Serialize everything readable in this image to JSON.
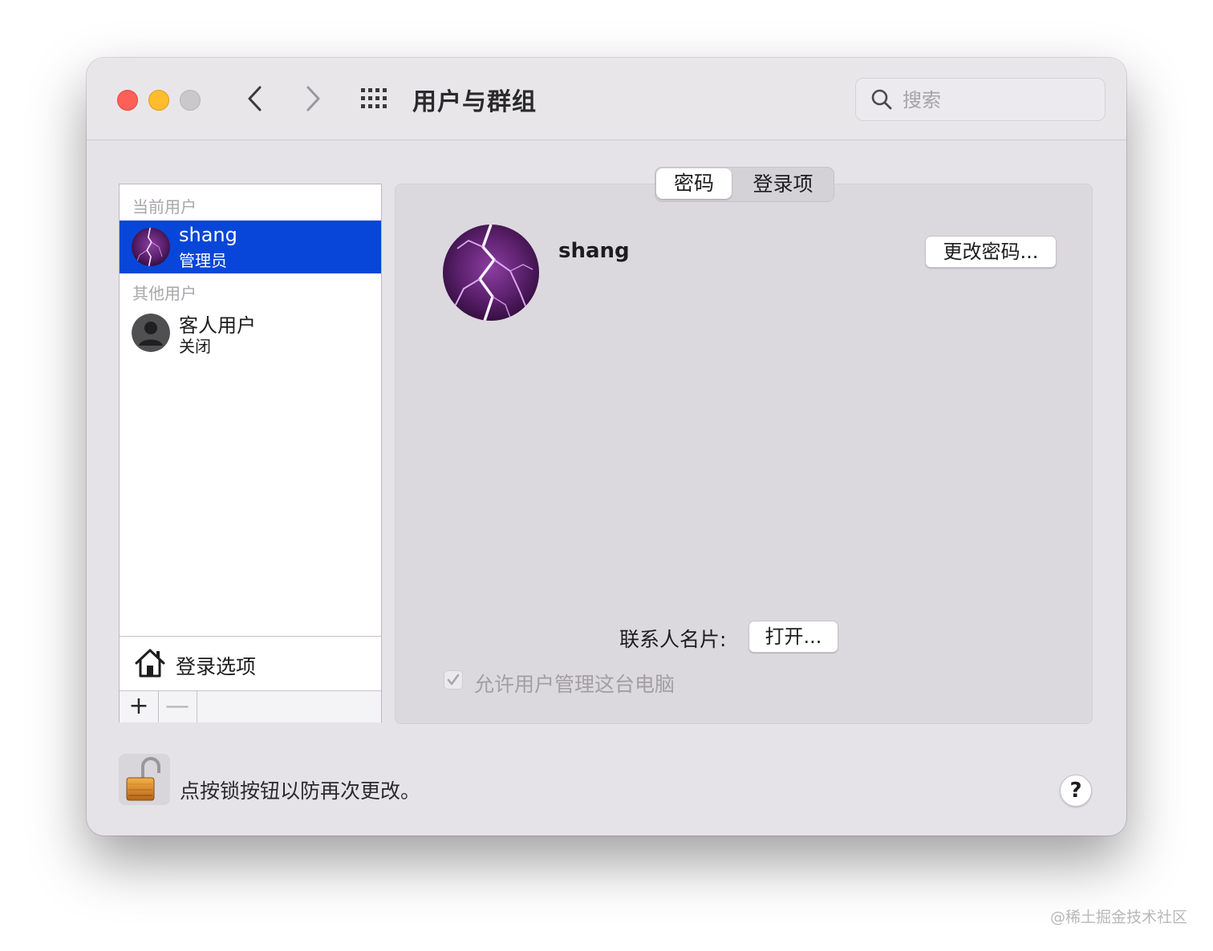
{
  "window": {
    "title": "用户与群组",
    "search_placeholder": "搜索"
  },
  "sidebar": {
    "current_header": "当前用户",
    "current_user": {
      "name": "shang",
      "role": "管理员"
    },
    "other_header": "其他用户",
    "other_users": [
      {
        "name": "客人用户",
        "role": "关闭"
      }
    ],
    "login_options_label": "登录选项",
    "add_label": "+",
    "remove_label": "—"
  },
  "tabs": [
    {
      "label": "密码",
      "selected": true
    },
    {
      "label": "登录项",
      "selected": false
    }
  ],
  "main": {
    "user_name": "shang",
    "change_password_label": "更改密码...",
    "contact_card_label": "联系人名片:",
    "open_button_label": "打开...",
    "admin_checkbox_label": "允许用户管理这台电脑",
    "admin_checkbox_checked": true
  },
  "footer": {
    "lock_text": "点按锁按钮以防再次更改。",
    "help_label": "?"
  },
  "watermark": "@稀土掘金技术社区",
  "colors": {
    "selection": "#0746d8",
    "close": "#fe5f57",
    "minimize": "#febc2e",
    "zoom_inactive": "#cbc8cc"
  },
  "icons": [
    "chevron-left-icon",
    "chevron-right-icon",
    "grid-icon",
    "search-icon",
    "house-icon",
    "lock-icon",
    "person-icon",
    "checkmark-icon"
  ]
}
